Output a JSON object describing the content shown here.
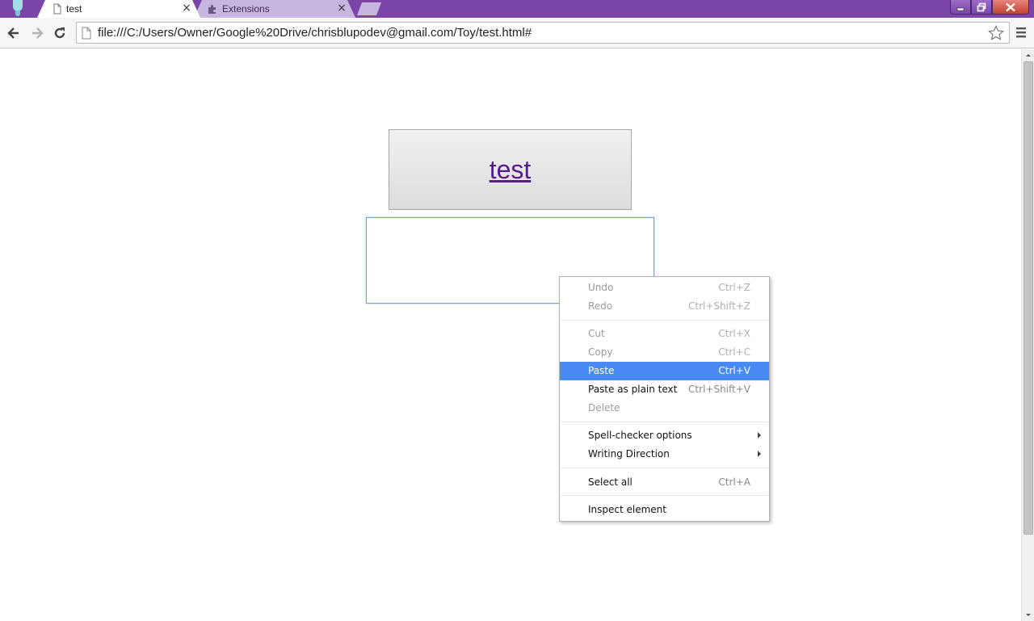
{
  "browser": {
    "tabs": [
      {
        "label": "test",
        "icon": "page-icon",
        "active": true
      },
      {
        "label": "Extensions",
        "icon": "puzzle-icon",
        "active": false
      }
    ],
    "window_buttons": [
      "minimize-icon",
      "restore-icon",
      "close-icon"
    ],
    "url": "file:///C:/Users/Owner/Google%20Drive/chrisblupodev@gmail.com/Toy/test.html#",
    "colors": {
      "frame": "#7b45a8",
      "highlight": "#4a8af4",
      "link": "#551a8b"
    }
  },
  "page": {
    "link_text": "test"
  },
  "context_menu": {
    "items": [
      {
        "label": "Undo",
        "shortcut": "Ctrl+Z",
        "enabled": false
      },
      {
        "label": "Redo",
        "shortcut": "Ctrl+Shift+Z",
        "enabled": false
      },
      {
        "label": "Cut",
        "shortcut": "Ctrl+X",
        "enabled": false
      },
      {
        "label": "Copy",
        "shortcut": "Ctrl+C",
        "enabled": false
      },
      {
        "label": "Paste",
        "shortcut": "Ctrl+V",
        "enabled": true,
        "highlighted": true
      },
      {
        "label": "Paste as plain text",
        "shortcut": "Ctrl+Shift+V",
        "enabled": true
      },
      {
        "label": "Delete",
        "shortcut": "",
        "enabled": false
      },
      {
        "label": "Spell-checker options",
        "shortcut": "",
        "enabled": true,
        "submenu": true
      },
      {
        "label": "Writing Direction",
        "shortcut": "",
        "enabled": true,
        "submenu": true
      },
      {
        "label": "Select all",
        "shortcut": "Ctrl+A",
        "enabled": true
      },
      {
        "label": "Inspect element",
        "shortcut": "",
        "enabled": true
      }
    ]
  }
}
